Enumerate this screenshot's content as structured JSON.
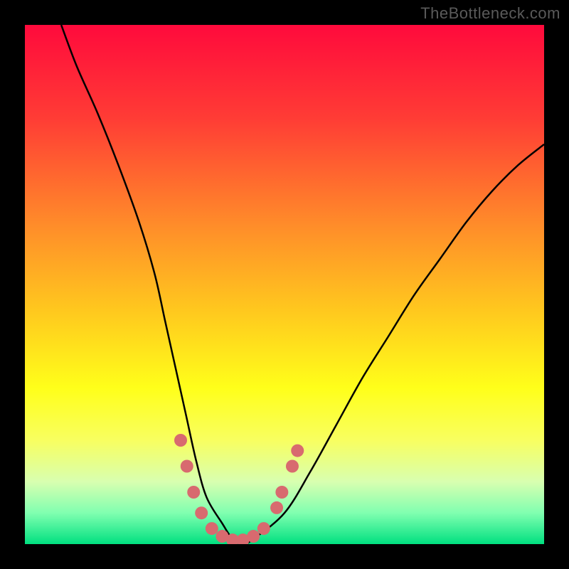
{
  "watermark": "TheBottleneck.com",
  "chart_data": {
    "type": "line",
    "title": "",
    "xlabel": "",
    "ylabel": "",
    "xlim": [
      0,
      100
    ],
    "ylim": [
      0,
      100
    ],
    "gradient_stops": [
      {
        "offset": 0,
        "color": "#ff0a3c"
      },
      {
        "offset": 18,
        "color": "#ff3c35"
      },
      {
        "offset": 38,
        "color": "#ff8a2a"
      },
      {
        "offset": 55,
        "color": "#ffc81e"
      },
      {
        "offset": 70,
        "color": "#ffff1a"
      },
      {
        "offset": 80,
        "color": "#f8ff60"
      },
      {
        "offset": 88,
        "color": "#d8ffb0"
      },
      {
        "offset": 94,
        "color": "#80ffb0"
      },
      {
        "offset": 100,
        "color": "#00e080"
      }
    ],
    "series": [
      {
        "name": "bottleneck-curve",
        "x": [
          7,
          10,
          14,
          18,
          22,
          25,
          27,
          29,
          31,
          33,
          35,
          38,
          40,
          42,
          44,
          50,
          55,
          60,
          65,
          70,
          75,
          80,
          85,
          90,
          95,
          100
        ],
        "y": [
          100,
          92,
          83,
          73,
          62,
          52,
          43,
          34,
          25,
          16,
          9,
          4,
          1,
          0,
          1,
          6,
          14,
          23,
          32,
          40,
          48,
          55,
          62,
          68,
          73,
          77
        ]
      }
    ],
    "markers": {
      "name": "highlight-dots",
      "color": "#d86a6f",
      "radius": 9,
      "points": [
        {
          "x": 30.0,
          "y": 20.0
        },
        {
          "x": 31.2,
          "y": 15.0
        },
        {
          "x": 32.5,
          "y": 10.0
        },
        {
          "x": 34.0,
          "y": 6.0
        },
        {
          "x": 36.0,
          "y": 3.0
        },
        {
          "x": 38.0,
          "y": 1.5
        },
        {
          "x": 40.0,
          "y": 0.8
        },
        {
          "x": 42.0,
          "y": 0.8
        },
        {
          "x": 44.0,
          "y": 1.5
        },
        {
          "x": 46.0,
          "y": 3.0
        },
        {
          "x": 48.5,
          "y": 7.0
        },
        {
          "x": 49.5,
          "y": 10.0
        },
        {
          "x": 51.5,
          "y": 15.0
        },
        {
          "x": 52.5,
          "y": 18.0
        }
      ]
    }
  }
}
